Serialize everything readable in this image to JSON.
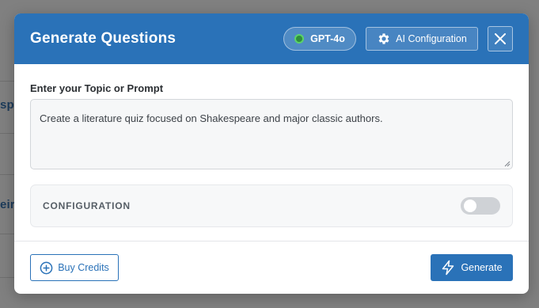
{
  "modal": {
    "title": "Generate Questions",
    "model_label": "GPT-4o",
    "model_status_color": "#5bd36a",
    "config_button_label": "AI Configuration",
    "config_button_icon": "gear-icon",
    "close_icon": "close-icon"
  },
  "form": {
    "prompt_label": "Enter your Topic or Prompt",
    "prompt_value": "Create a literature quiz focused on Shakespeare and major classic authors.",
    "configuration_label": "CONFIGURATION",
    "configuration_enabled": false
  },
  "footer": {
    "buy_credits_label": "Buy Credits",
    "buy_credits_icon": "plus-circle-icon",
    "generate_label": "Generate",
    "generate_icon": "lightning-icon"
  },
  "background": {
    "fragment_1": "spl",
    "fragment_2": "eir"
  },
  "colors": {
    "accent": "#2a72b8",
    "overlay": "#808080"
  }
}
